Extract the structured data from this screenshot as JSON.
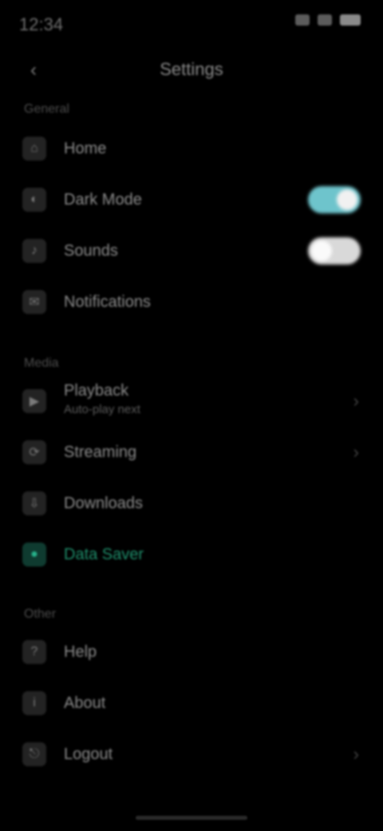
{
  "status_bar": {
    "time": "12:34"
  },
  "topbar": {
    "back_icon": "‹",
    "title": "Settings"
  },
  "sections": [
    {
      "header": "General"
    },
    {
      "header": "Media"
    },
    {
      "header": "Other"
    }
  ],
  "rows": [
    {
      "icon": "⌂",
      "label": "Home",
      "kind": "plain"
    },
    {
      "icon": "◐",
      "label": "Dark Mode",
      "kind": "toggle",
      "state": "on"
    },
    {
      "icon": "♪",
      "label": "Sounds",
      "kind": "toggle",
      "state": "off"
    },
    {
      "icon": "✉",
      "label": "Notifications",
      "kind": "plain"
    },
    {
      "icon": "▶",
      "label": "Playback",
      "sub": "Auto-play next",
      "kind": "chevron"
    },
    {
      "icon": "⟳",
      "label": "Streaming",
      "kind": "chevron"
    },
    {
      "icon": "⇩",
      "label": "Downloads",
      "kind": "plain"
    },
    {
      "icon": "●",
      "label": "Data Saver",
      "kind": "plain",
      "selected": true
    },
    {
      "icon": "?",
      "label": "Help",
      "kind": "plain"
    },
    {
      "icon": "i",
      "label": "About",
      "kind": "plain"
    },
    {
      "icon": "⎋",
      "label": "Logout",
      "kind": "chevron"
    }
  ],
  "icons": {
    "back": "back-arrow-icon",
    "chevron": "chevron-right-icon"
  },
  "colors": {
    "background": "#000000",
    "toggle_on": "#6ec4cc",
    "toggle_off": "#d9d9d9",
    "selected_accent": "#1f8f6c"
  }
}
